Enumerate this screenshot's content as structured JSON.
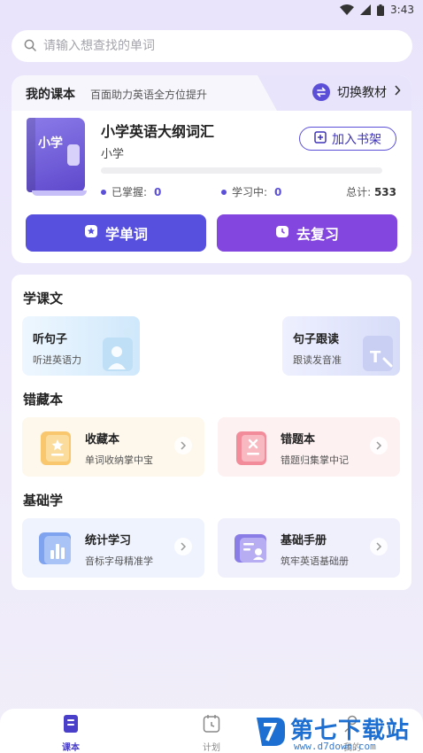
{
  "status_bar": {
    "time": "3:43"
  },
  "search": {
    "placeholder": "请输入想查找的单词"
  },
  "my_textbook": {
    "tab_title": "我的课本",
    "tab_subtitle": "百面助力英语全方位提升",
    "switch_label": "切换教材",
    "cover_text": "小学",
    "book_name": "小学英语大纲词汇",
    "level": "小学",
    "add_shelf_label": "加入书架",
    "progress": 0,
    "mastered_label": "已掌握:",
    "mastered_value": "0",
    "learning_label": "学习中:",
    "learning_value": "0",
    "total_label": "总计:",
    "total_value": "533",
    "learn_btn": "学单词",
    "review_btn": "去复习"
  },
  "sections": {
    "lessons": {
      "title": "学课文",
      "items": [
        {
          "title": "听句子",
          "subtitle": "听进英语力"
        },
        {
          "title": "句子跟读",
          "subtitle": "跟读发音准"
        }
      ]
    },
    "notebook": {
      "title": "错藏本",
      "items": [
        {
          "title": "收藏本",
          "subtitle": "单词收纳掌中宝"
        },
        {
          "title": "错题本",
          "subtitle": "错题归集掌中记"
        }
      ]
    },
    "basics": {
      "title": "基础学",
      "items": [
        {
          "title": "统计学习",
          "subtitle": "音标字母精准学"
        },
        {
          "title": "基础手册",
          "subtitle": "筑牢英语基础册"
        }
      ]
    }
  },
  "bottom_nav": {
    "items": [
      {
        "label": "课本",
        "icon": "book-icon",
        "active": true
      },
      {
        "label": "计划",
        "icon": "calendar-icon",
        "active": false
      },
      {
        "label": "我的",
        "icon": "user-icon",
        "active": false
      }
    ]
  },
  "watermark": {
    "brand": "第七下载站",
    "url": "www.d7down.com"
  },
  "colors": {
    "primary": "#5b4fd8",
    "review": "#8346de",
    "background": "#ece8fb"
  }
}
